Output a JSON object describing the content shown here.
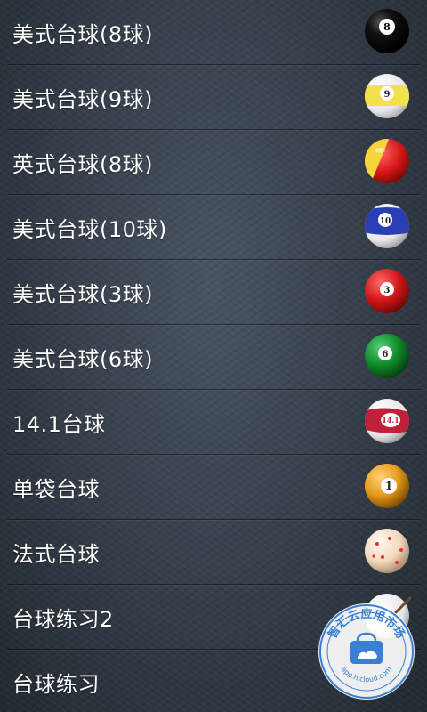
{
  "items": [
    {
      "label": "美式台球(8球)",
      "icon": "eight-ball-icon",
      "ball_number": "8",
      "color": "#111111",
      "stripe": false
    },
    {
      "label": "美式台球(9球)",
      "icon": "nine-ball-icon",
      "ball_number": "9",
      "color": "#f2e14a",
      "stripe": true
    },
    {
      "label": "英式台球(8球)",
      "icon": "red-yellow-ball-icon",
      "ball_number": "",
      "color": "#e31b1b"
    },
    {
      "label": "美式台球(10球)",
      "icon": "ten-ball-icon",
      "ball_number": "10",
      "color": "#2a3fb5",
      "stripe": true
    },
    {
      "label": "美式台球(3球)",
      "icon": "three-ball-icon",
      "ball_number": "3",
      "color": "#d3181a",
      "stripe": false
    },
    {
      "label": "美式台球(6球)",
      "icon": "six-ball-icon",
      "ball_number": "6",
      "color": "#0f8a2a",
      "stripe": false
    },
    {
      "label": "14.1台球",
      "icon": "fourteen-one-ball-icon",
      "ball_number": "14.1",
      "color": "#c0203a",
      "stripe": true
    },
    {
      "label": "单袋台球",
      "icon": "one-ball-icon",
      "ball_number": "1",
      "color": "#e59a1a",
      "stripe": false
    },
    {
      "label": "法式台球",
      "icon": "carom-ball-icon",
      "ball_number": "",
      "color": "#f0d7bd"
    },
    {
      "label": "台球练习2",
      "icon": "cue-ball-icon",
      "ball_number": "",
      "color": "#f2f2f2"
    },
    {
      "label": "台球练习",
      "icon": "cue-ball-icon",
      "ball_number": "",
      "color": "#f2f2f2"
    }
  ],
  "watermark": {
    "title": "智汇云应用市场",
    "url": "app.hicloud.com",
    "color": "#3b7fd4"
  }
}
